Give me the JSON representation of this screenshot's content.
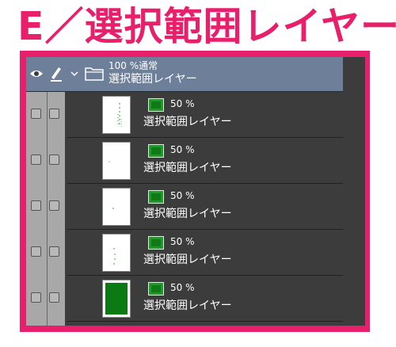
{
  "heading": "E／選択範囲レイヤー",
  "folder": {
    "opacity_mode": "100 %通常",
    "name": "選択範囲レイヤー"
  },
  "layers": [
    {
      "opacity": "50 %",
      "name": "選択範囲レイヤー",
      "thumbnail": "sparse-green-marks"
    },
    {
      "opacity": "50 %",
      "name": "選択範囲レイヤー",
      "thumbnail": "blank-white"
    },
    {
      "opacity": "50 %",
      "name": "選択範囲レイヤー",
      "thumbnail": "tiny-green-dot"
    },
    {
      "opacity": "50 %",
      "name": "選択範囲レイヤー",
      "thumbnail": "sparse-green-dots"
    },
    {
      "opacity": "50 %",
      "name": "選択範囲レイヤー",
      "thumbnail": "solid-green"
    }
  ],
  "colors": {
    "accent": "#e8206b",
    "panel": "#3c3c3c",
    "folder_row": "#6d7f99",
    "selection_green": "#1f9a2a"
  }
}
